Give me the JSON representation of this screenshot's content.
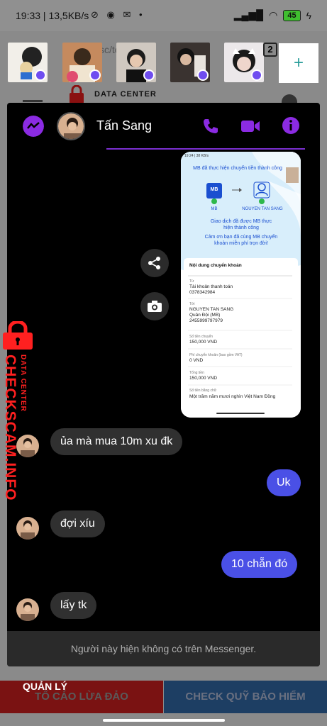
{
  "status_bar": {
    "time": "19:33",
    "speed": "13,5KB/s",
    "battery": "45"
  },
  "background": {
    "url_fragment": "sc/to  a-c",
    "tab_count": "2",
    "title": "DATA CENTER"
  },
  "chat": {
    "contact_name": "Tấn Sang",
    "messages": [
      {
        "from": "them",
        "text": "ủa mà mua 10m xu đk"
      },
      {
        "from": "me",
        "text": "Uk"
      },
      {
        "from": "them",
        "text": "đợi xíu"
      },
      {
        "from": "me",
        "text": "10 chẵn đó"
      },
      {
        "from": "them",
        "text": "lấy tk"
      }
    ],
    "unavailable_notice": "Người này hiện không có trên Messenger."
  },
  "receipt": {
    "status_time": "19:24 | 38 KB/s",
    "title": "MB đã thực hiện chuyển tiền thành công",
    "from_bank": "MB",
    "to_name": "NGUYEN TAN SANG",
    "success_text": "Giao dịch đã được MB thực hiện thành công",
    "thanks_text": "Cảm ơn bạn đã cùng MB chuyển khoản miễn phí trọn đời!",
    "section_title": "Nội dung chuyển khoản",
    "rows": [
      {
        "label": "Từ",
        "value": "Tài khoản thanh toán\n0378342984"
      },
      {
        "label": "Tới",
        "value": "NGUYEN TAN SANG\nQuân Đội (MB)\n2455999797979"
      },
      {
        "label": "Số tiền chuyển",
        "value": "150,000 VND"
      },
      {
        "label": "Phí chuyển khoản (bao gồm VAT)",
        "value": "0 VND"
      },
      {
        "label": "Tổng tiền",
        "value": "150,000 VND"
      },
      {
        "label": "Số tiền bằng chữ",
        "value": "Một trăm năm mươi nghìn Việt Nam Đồng"
      }
    ]
  },
  "watermark": {
    "brand": "CHECKSCAM.INFO",
    "sub": "DATA CENTER"
  },
  "bottom": {
    "manage_label": "QUẢN LÝ",
    "report_label": "TỐ CÁO LỪA ĐẢO",
    "insurance_label": "CHECK QUỸ BẢO HIỂM"
  },
  "colors": {
    "accent": "#8b2be2",
    "my_bubble": "#4a50e6",
    "their_bubble": "#303030",
    "watermark": "#ff2020"
  }
}
